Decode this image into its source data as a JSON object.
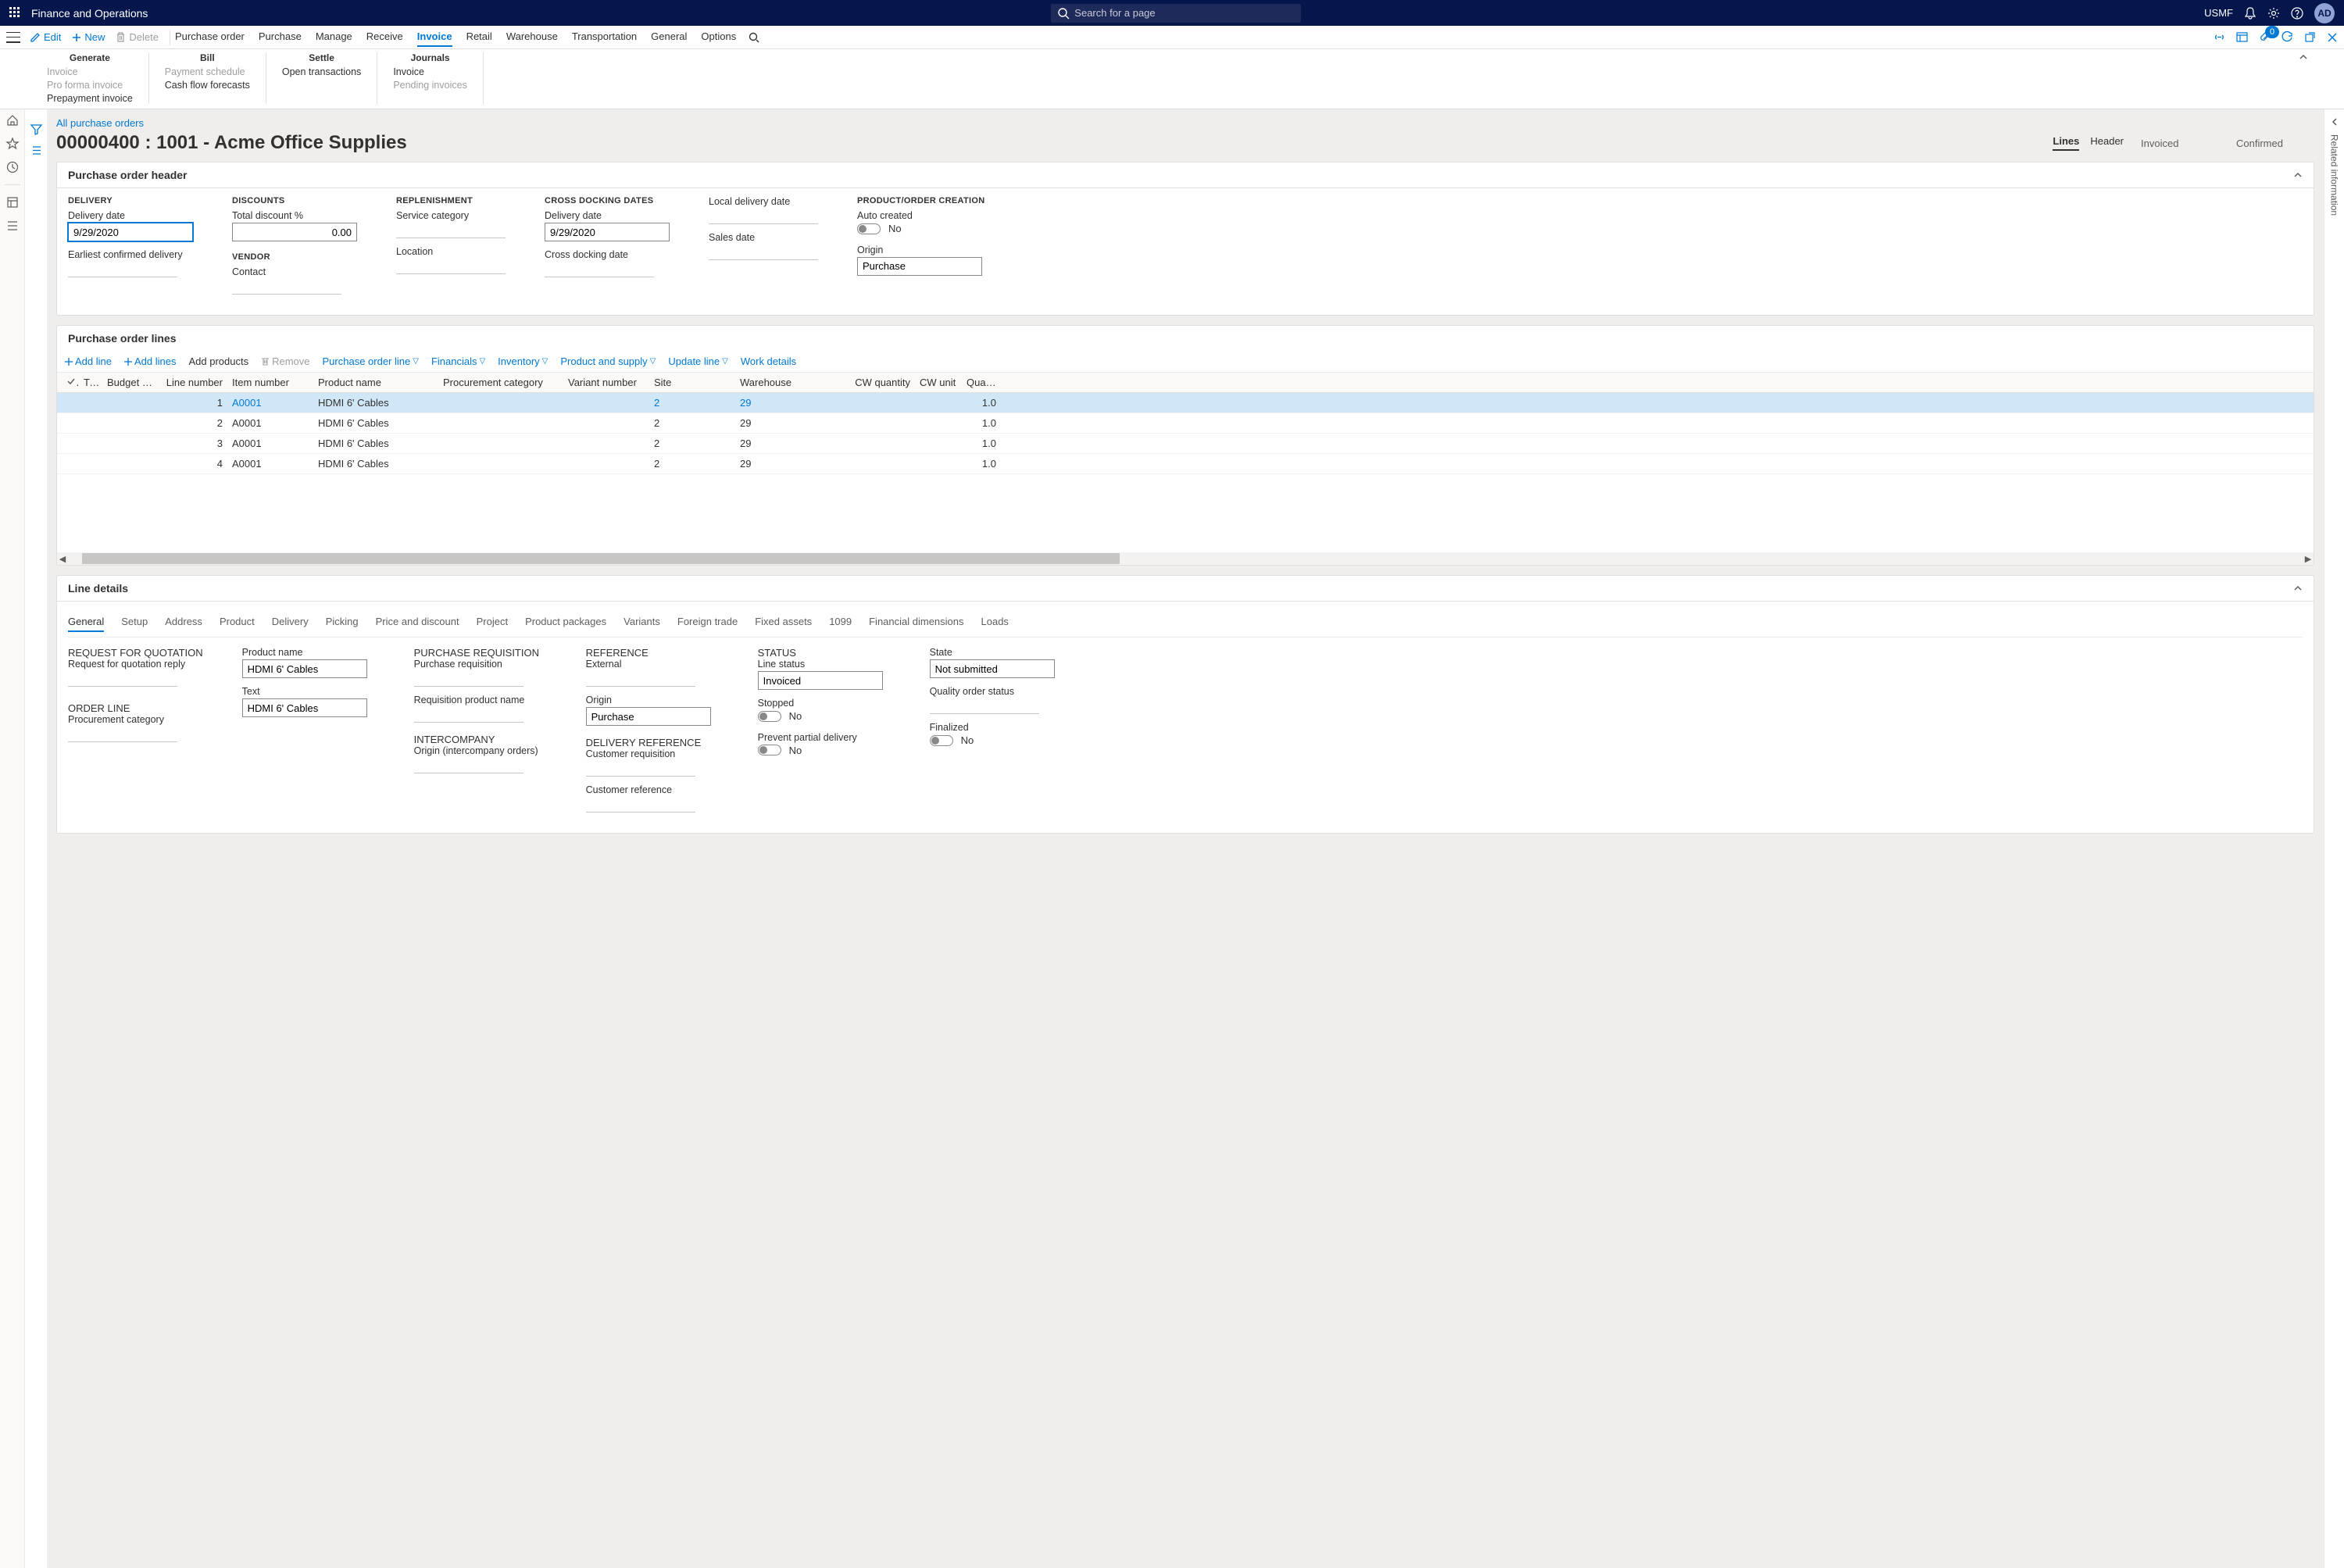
{
  "app": {
    "title": "Finance and Operations",
    "search_placeholder": "Search for a page",
    "company": "USMF",
    "user_initials": "AD"
  },
  "actionbar": {
    "edit": "Edit",
    "new": "New",
    "delete": "Delete",
    "tabs": [
      "Purchase order",
      "Purchase",
      "Manage",
      "Receive",
      "Invoice",
      "Retail",
      "Warehouse",
      "Transportation",
      "General",
      "Options"
    ],
    "active_tab": "Invoice",
    "attach_count": "0"
  },
  "ribbon": {
    "groups": [
      {
        "title": "Generate",
        "items": [
          {
            "l": "Invoice",
            "dim": true
          },
          {
            "l": "Pro forma invoice",
            "dim": true
          },
          {
            "l": "Prepayment invoice",
            "dim": false
          }
        ]
      },
      {
        "title": "Bill",
        "items": [
          {
            "l": "Payment schedule",
            "dim": true
          },
          {
            "l": "Cash flow forecasts",
            "dim": false
          }
        ]
      },
      {
        "title": "Settle",
        "items": [
          {
            "l": "Open transactions",
            "dim": false
          }
        ]
      },
      {
        "title": "Journals",
        "items": [
          {
            "l": "Invoice",
            "dim": false
          },
          {
            "l": "Pending invoices",
            "dim": true
          }
        ]
      }
    ]
  },
  "page": {
    "breadcrumb": "All purchase orders",
    "title": "00000400 : 1001 - Acme Office Supplies",
    "view_seg": {
      "lines": "Lines",
      "header": "Header",
      "active": "Lines"
    },
    "status1": "Invoiced",
    "status2": "Confirmed"
  },
  "po_header": {
    "title": "Purchase order header",
    "delivery": {
      "label": "DELIVERY",
      "date_l": "Delivery date",
      "date_v": "9/29/2020",
      "ecd_l": "Earliest confirmed delivery"
    },
    "discounts": {
      "label": "DISCOUNTS",
      "tdp_l": "Total discount %",
      "tdp_v": "0.00"
    },
    "vendor": {
      "label": "VENDOR",
      "contact_l": "Contact"
    },
    "replenish": {
      "label": "REPLENISHMENT",
      "sc_l": "Service category",
      "loc_l": "Location"
    },
    "cross": {
      "label": "CROSS DOCKING DATES",
      "dd_l": "Delivery date",
      "dd_v": "9/29/2020",
      "cdd_l": "Cross docking date"
    },
    "misc": {
      "ldd_l": "Local delivery date",
      "sd_l": "Sales date"
    },
    "prod": {
      "label": "PRODUCT/ORDER CREATION",
      "auto_l": "Auto created",
      "auto_v": "No",
      "origin_l": "Origin",
      "origin_v": "Purchase"
    }
  },
  "po_lines": {
    "title": "Purchase order lines",
    "toolbar": {
      "add_line": "Add line",
      "add_lines": "Add lines",
      "add_products": "Add products",
      "remove": "Remove",
      "pol": "Purchase order line",
      "fin": "Financials",
      "inv": "Inventory",
      "pas": "Product and supply",
      "upd": "Update line",
      "wd": "Work details"
    },
    "cols": {
      "typ": "Typ",
      "bud": "Budget chec...",
      "lnum": "Line number",
      "item": "Item number",
      "pname": "Product name",
      "proc": "Procurement category",
      "var": "Variant number",
      "site": "Site",
      "wh": "Warehouse",
      "cwq": "CW quantity",
      "cwu": "CW unit",
      "qty": "Quanti"
    },
    "rows": [
      {
        "lnum": "1",
        "item": "A0001",
        "pname": "HDMI 6' Cables",
        "site": "2",
        "wh": "29",
        "qty": "1.0",
        "sel": true
      },
      {
        "lnum": "2",
        "item": "A0001",
        "pname": "HDMI 6' Cables",
        "site": "2",
        "wh": "29",
        "qty": "1.0"
      },
      {
        "lnum": "3",
        "item": "A0001",
        "pname": "HDMI 6' Cables",
        "site": "2",
        "wh": "29",
        "qty": "1.0"
      },
      {
        "lnum": "4",
        "item": "A0001",
        "pname": "HDMI 6' Cables",
        "site": "2",
        "wh": "29",
        "qty": "1.0"
      }
    ]
  },
  "line_details": {
    "title": "Line details",
    "tabs": [
      "General",
      "Setup",
      "Address",
      "Product",
      "Delivery",
      "Picking",
      "Price and discount",
      "Project",
      "Product packages",
      "Variants",
      "Foreign trade",
      "Fixed assets",
      "1099",
      "Financial dimensions",
      "Loads"
    ],
    "active_tab": "General",
    "rfq": {
      "label": "REQUEST FOR QUOTATION",
      "reply_l": "Request for quotation reply"
    },
    "orderline": {
      "label": "ORDER LINE",
      "proc_l": "Procurement category"
    },
    "prod": {
      "name_l": "Product name",
      "name_v": "HDMI 6' Cables",
      "text_l": "Text",
      "text_v": "HDMI 6' Cables"
    },
    "preq": {
      "label": "PURCHASE REQUISITION",
      "pr_l": "Purchase requisition",
      "rpn_l": "Requisition product name"
    },
    "inter": {
      "label": "INTERCOMPANY",
      "oi_l": "Origin (intercompany orders)"
    },
    "ref": {
      "label": "REFERENCE",
      "ext_l": "External",
      "origin_l": "Origin",
      "origin_v": "Purchase"
    },
    "dref": {
      "label": "DELIVERY REFERENCE",
      "cr_l": "Customer requisition",
      "cref_l": "Customer reference"
    },
    "status": {
      "label": "STATUS",
      "ls_l": "Line status",
      "ls_v": "Invoiced",
      "stopped_l": "Stopped",
      "stopped_v": "No",
      "ppd_l": "Prevent partial delivery",
      "ppd_v": "No"
    },
    "state": {
      "state_l": "State",
      "state_v": "Not submitted",
      "qos_l": "Quality order status",
      "fin_l": "Finalized",
      "fin_v": "No"
    }
  },
  "rightrail": {
    "label": "Related information"
  }
}
